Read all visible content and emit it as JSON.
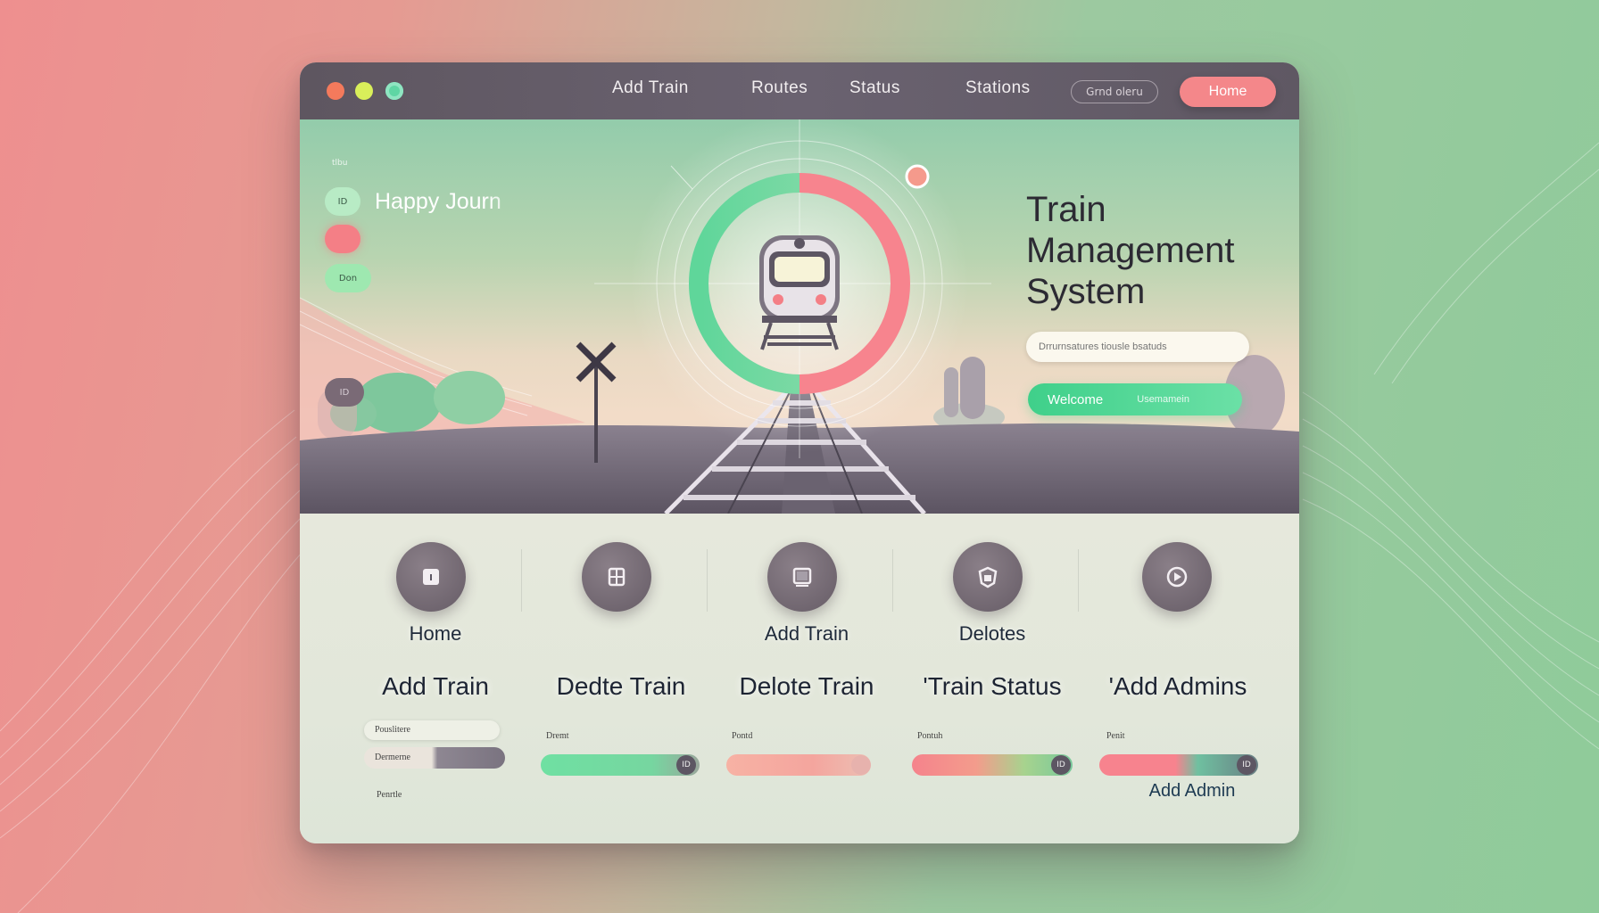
{
  "window": {
    "nav": [
      "Add Train",
      "Routes",
      "Status",
      "Stations"
    ],
    "search_label": "Grnd oleru",
    "home_button": "Home"
  },
  "hero": {
    "side_label": "Happy Journ",
    "side_small": "tlbu",
    "pills": [
      "ID",
      "",
      "Don",
      "ID"
    ],
    "title_lines": [
      "Train",
      "Management",
      "System"
    ],
    "input_placeholder": "Drrurnsatures tiousle bsatuds",
    "welcome_button": "Welcome",
    "welcome_sub": "Usemamein"
  },
  "columns": [
    {
      "label": "Home",
      "heading": "Add Train",
      "icon": "door-icon",
      "fields": [
        "Pouslitere",
        "Dermerne",
        "Penrtle"
      ],
      "progress": [
        0.5,
        0.4
      ]
    },
    {
      "label": "",
      "heading": "Dedte Train",
      "icon": "document-icon",
      "fields": [
        "Dremt"
      ],
      "progress": [
        0.85
      ],
      "knob": "ID"
    },
    {
      "label": "Add Train",
      "heading": "Delote Train",
      "icon": "monitor-icon",
      "fields": [
        "Pontd"
      ],
      "progress": [
        0.9
      ],
      "knob": ""
    },
    {
      "label": "Delotes",
      "heading": "'Train Status",
      "icon": "shield-icon",
      "fields": [
        "Pontuh"
      ],
      "progress": [
        0.85
      ],
      "knob": "ID"
    },
    {
      "label": "",
      "heading": "'Add Admins",
      "icon": "play-icon",
      "fields": [
        "Penit"
      ],
      "progress": [
        0.85
      ],
      "knob": "ID"
    }
  ],
  "footer_link": "Add Admin",
  "colors": {
    "accent_green": "#3fd08a",
    "accent_pink": "#f4878a",
    "titlebar": "#5e5660"
  }
}
